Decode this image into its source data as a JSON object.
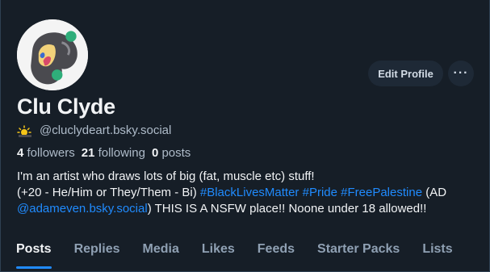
{
  "profile": {
    "name": "Clu Clyde",
    "handle": "@cluclydeart.bsky.social",
    "handle_emoji_icon": "sun-behind-cloud-icon"
  },
  "actions": {
    "edit_label": "Edit Profile",
    "more_label": "···"
  },
  "stats": {
    "followers_count": "4",
    "followers_label": "followers",
    "following_count": "21",
    "following_label": "following",
    "posts_count": "0",
    "posts_label": "posts"
  },
  "bio": {
    "line1": "I'm an artist who draws lots of big (fat, muscle etc) stuff!",
    "line2_prefix": "(+20 - He/Him or They/Them - Bi) ",
    "tag1": "#BlackLivesMatter",
    "tag2": "#Pride",
    "tag3": "#FreePalestine",
    "line2_suffix": " (AD",
    "mention": "@adameven.bsky.social",
    "line3_suffix": ") THIS IS A NSFW place!! Noone under 18 allowed!!"
  },
  "tabs": [
    {
      "label": "Posts",
      "active": true
    },
    {
      "label": "Replies"
    },
    {
      "label": "Media"
    },
    {
      "label": "Likes"
    },
    {
      "label": "Feeds"
    },
    {
      "label": "Starter Packs"
    },
    {
      "label": "Lists"
    }
  ],
  "colors": {
    "background": "#161e27",
    "link": "#208bfe",
    "button_bg": "#1e2936",
    "muted_text": "#aebbc9"
  }
}
